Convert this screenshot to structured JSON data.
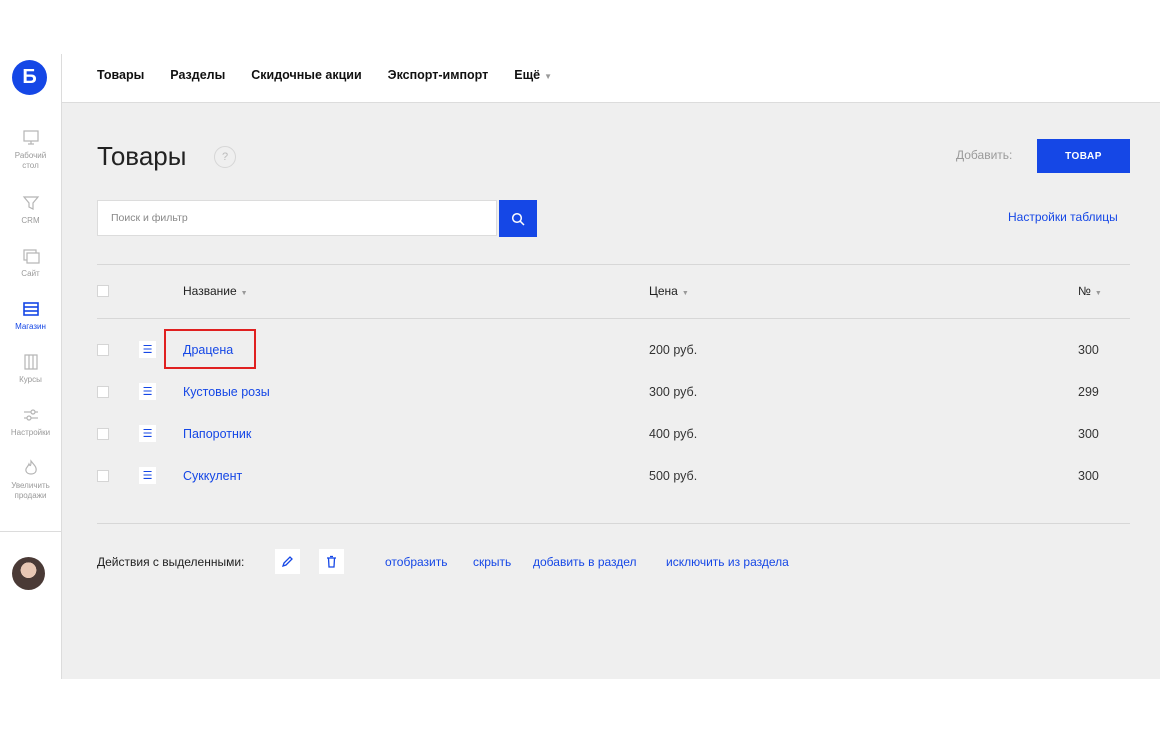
{
  "app": {
    "logo_letter": "Б"
  },
  "sidebar": {
    "items": [
      {
        "label_line1": "Рабочий",
        "label_line2": "стол",
        "icon": "desktop-icon"
      },
      {
        "label_line1": "CRM",
        "label_line2": "",
        "icon": "funnel-icon"
      },
      {
        "label_line1": "Сайт",
        "label_line2": "",
        "icon": "site-icon"
      },
      {
        "label_line1": "Магазин",
        "label_line2": "",
        "icon": "shop-icon",
        "active": true
      },
      {
        "label_line1": "Курсы",
        "label_line2": "",
        "icon": "courses-icon"
      },
      {
        "label_line1": "Настройки",
        "label_line2": "",
        "icon": "settings-icon"
      },
      {
        "label_line1": "Увеличить",
        "label_line2": "продажи",
        "icon": "flame-icon"
      }
    ]
  },
  "topnav": {
    "items": [
      "Товары",
      "Разделы",
      "Скидочные акции",
      "Экспорт-импорт",
      "Ещё"
    ]
  },
  "page": {
    "title": "Товары",
    "help": "?",
    "add_label": "Добавить:",
    "add_button": "ТОВАР"
  },
  "search": {
    "placeholder": "Поиск и фильтр"
  },
  "table_settings": "Настройки таблицы",
  "table": {
    "headers": {
      "name": "Название",
      "price": "Цена",
      "num": "№"
    },
    "rows": [
      {
        "name": "Драцена",
        "price": "200 руб.",
        "num": "300"
      },
      {
        "name": "Кустовые розы",
        "price": "300 руб.",
        "num": "299"
      },
      {
        "name": "Папоротник",
        "price": "400 руб.",
        "num": "300"
      },
      {
        "name": "Суккулент",
        "price": "500 руб.",
        "num": "300"
      }
    ]
  },
  "bulk_actions": {
    "label": "Действия с выделенными:",
    "links": [
      "отобразить",
      "скрыть",
      "добавить в раздел",
      "исключить из раздела"
    ]
  },
  "colors": {
    "accent": "#1547e6",
    "highlight": "#e02020",
    "main_bg": "#efefef"
  }
}
